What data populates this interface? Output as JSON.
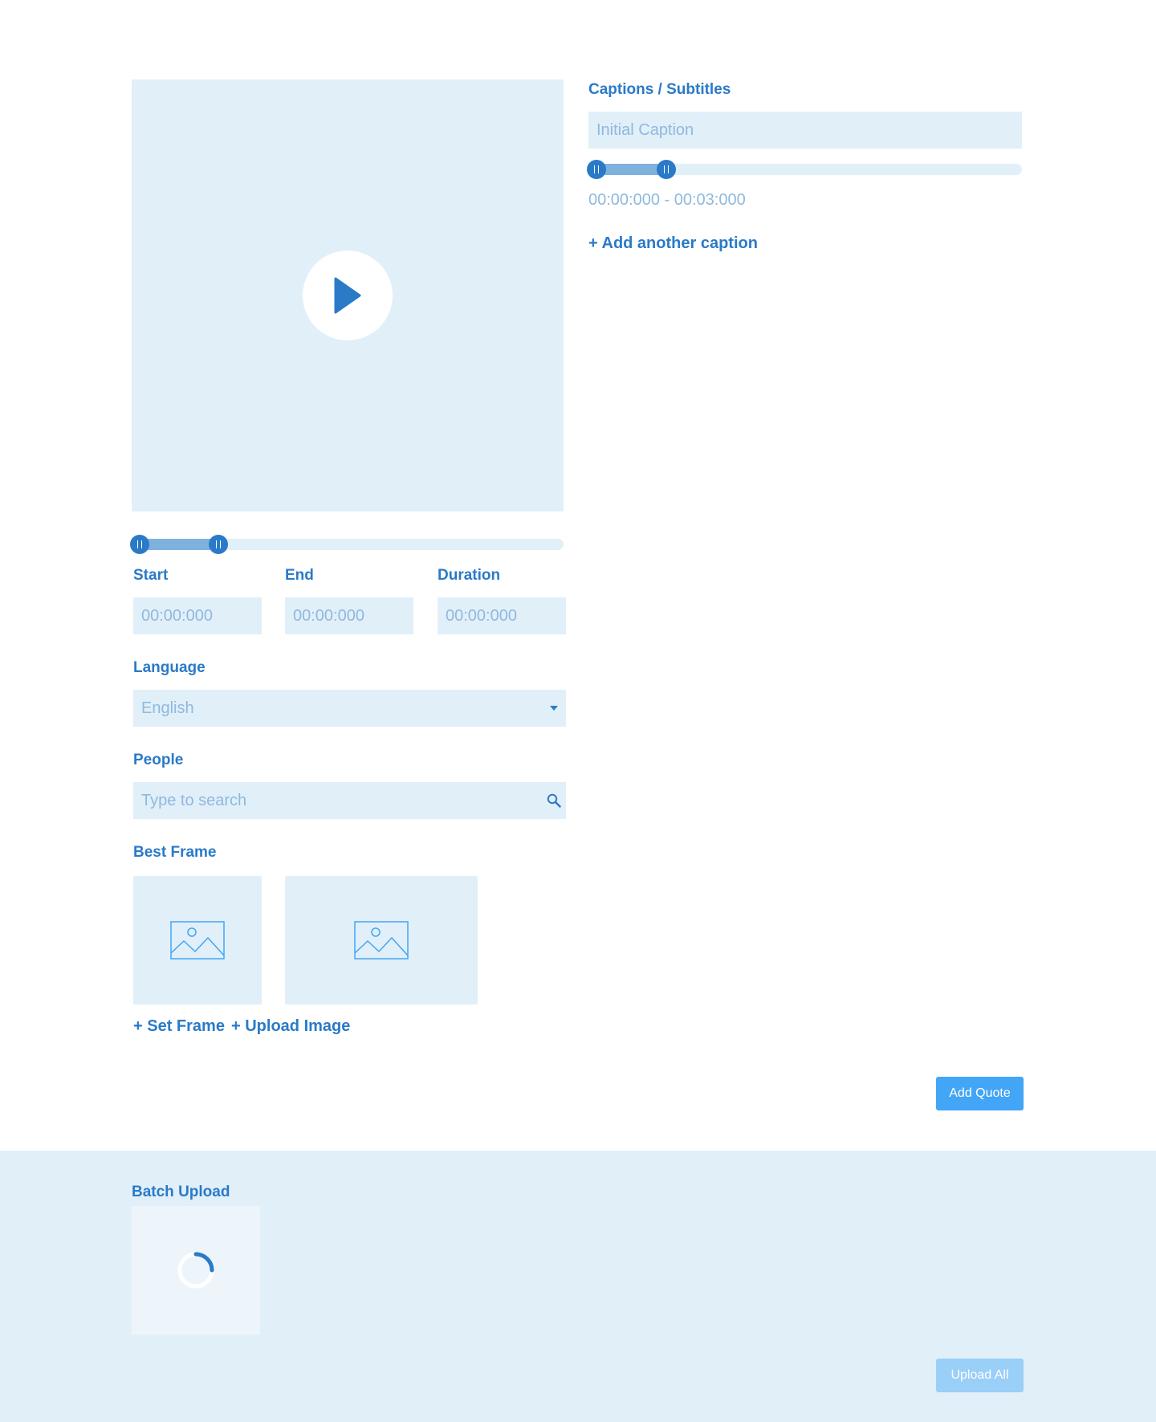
{
  "video": {
    "trim_start_pct": 0,
    "trim_end_pct": 20
  },
  "timing": {
    "start_label": "Start",
    "end_label": "End",
    "duration_label": "Duration",
    "start_placeholder": "00:00:000",
    "end_placeholder": "00:00:000",
    "duration_placeholder": "00:00:000"
  },
  "language": {
    "label": "Language",
    "selected": "English"
  },
  "people": {
    "label": "People",
    "placeholder": "Type to search"
  },
  "best_frame": {
    "label": "Best Frame",
    "set_frame": "+ Set Frame",
    "upload_image": "+ Upload Image"
  },
  "captions": {
    "title": "Captions / Subtitles",
    "placeholder": "Initial Caption",
    "range_text": "00:00:000 - 00:03:000",
    "add_another": "+ Add another caption",
    "range_start_pct": 0,
    "range_end_pct": 18
  },
  "actions": {
    "add_quote": "Add Quote"
  },
  "batch": {
    "title": "Batch Upload",
    "upload_all": "Upload All"
  },
  "colors": {
    "primary": "#2a7ac8",
    "panel": "#e1eff9",
    "button": "#42a5f5",
    "button_disabled": "#9acff7"
  },
  "icons": {
    "play": "play-icon",
    "dropdown": "caret-down-icon",
    "search": "search-icon",
    "image": "image-placeholder-icon",
    "spinner": "loading-spinner-icon"
  }
}
